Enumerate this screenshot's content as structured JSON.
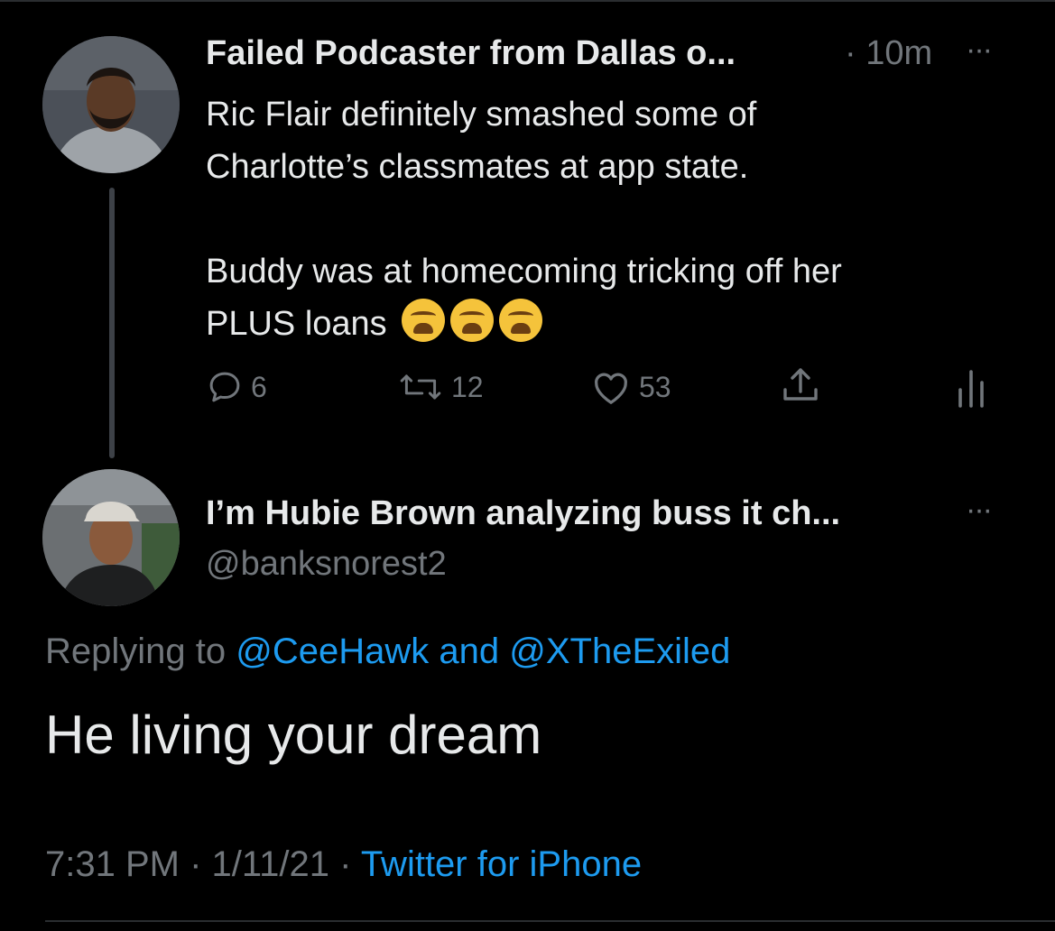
{
  "tweet": {
    "author_name": "Failed Podcaster from Dallas o...",
    "time": "· 10m",
    "more": "···",
    "text_line1": "Ric Flair definitely smashed some of",
    "text_line2": "Charlotte’s classmates at app state.",
    "text_line3": "Buddy was at homecoming tricking off her",
    "text_line4": "PLUS loans",
    "emojis": [
      "weary-face-emoji",
      "weary-face-emoji",
      "weary-face-emoji"
    ],
    "actions": {
      "reply_count": "6",
      "retweet_count": "12",
      "like_count": "53"
    }
  },
  "reply": {
    "author_name": "I’m Hubie Brown analyzing buss it ch...",
    "handle": "@banksnorest2",
    "more": "···",
    "replying_prefix": "Replying to",
    "replying_user1": "@CeeHawk",
    "replying_and": "and",
    "replying_user2": "@XTheExiled",
    "text": "He living your dream",
    "time": "7:31 PM · 1/11/21 ·",
    "source": "Twitter for iPhone"
  },
  "colors": {
    "background": "#000000",
    "text": "#e7e9ea",
    "muted": "#71767b",
    "accent": "#1d9bf0"
  }
}
